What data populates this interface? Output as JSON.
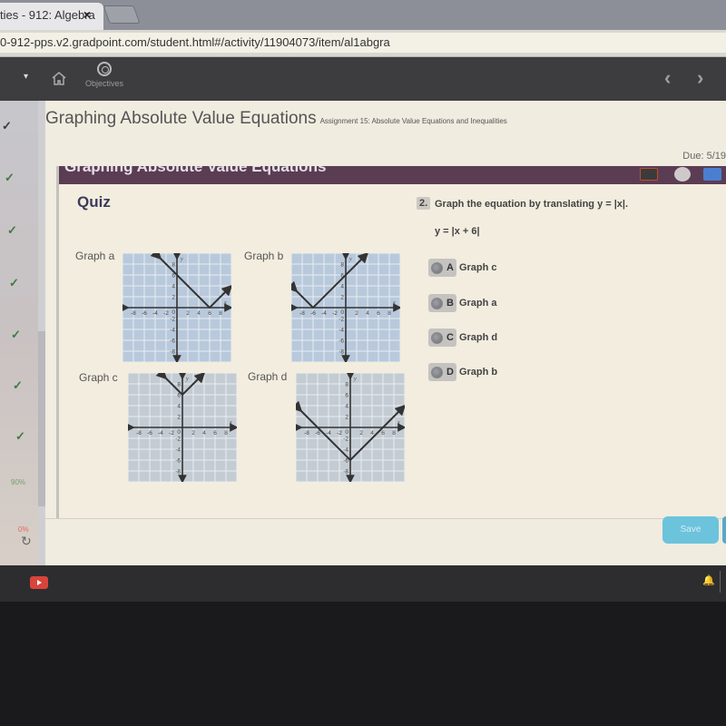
{
  "browser": {
    "tab_title": "ties - 912: Algebra",
    "tab_close": "×",
    "url": "0-912-pps.v2.gradpoint.com/student.html#/activity/11904073/item/al1abgra"
  },
  "app_nav": {
    "menu_caret": "▾",
    "home_icon": "home-icon",
    "objectives_label": "Objectives",
    "prev": "‹",
    "next": "›"
  },
  "sidebar": {
    "checks": [
      "✓",
      "✓",
      "✓",
      "✓",
      "✓",
      "✓",
      "✓"
    ],
    "progress_score": "90%",
    "progress_other": "0%",
    "reload": "↻"
  },
  "header": {
    "title": "Graphing Absolute Value Equations",
    "subtitle": "Assignment 15: Absolute Value Equations and Inequalities",
    "due": "Due: 5/19"
  },
  "frame": {
    "header_text": "Graphing Absolute Value Equations",
    "quiz_label": "Quiz"
  },
  "graphs": [
    {
      "label": "Graph a",
      "vertex": [
        6,
        0
      ],
      "opens": "up",
      "bg": "#b9c9dc"
    },
    {
      "label": "Graph b",
      "vertex": [
        -6,
        0
      ],
      "opens": "up",
      "bg": "#b9c9dc"
    },
    {
      "label": "Graph c",
      "vertex": [
        0,
        6
      ],
      "opens": "up",
      "bg": "#c4ccd3"
    },
    {
      "label": "Graph d",
      "vertex": [
        0,
        -6
      ],
      "opens": "up",
      "bg": "#c4ccd3"
    }
  ],
  "axis": {
    "x_ticks": [
      "-8",
      "-6",
      "-4",
      "-2",
      "2",
      "4",
      "6",
      "8"
    ],
    "y_ticks": [
      "8",
      "6",
      "4",
      "2",
      "-2",
      "-4",
      "-6",
      "-8"
    ],
    "origin": "0",
    "x_label": "x",
    "y_label": "y"
  },
  "question": {
    "number": "2.",
    "prompt": "Graph the equation by translating y = |x|.",
    "equation": "y = |x + 6|",
    "options": [
      {
        "letter": "A",
        "label": "Graph c"
      },
      {
        "letter": "B",
        "label": "Graph a"
      },
      {
        "letter": "C",
        "label": "Graph d"
      },
      {
        "letter": "D",
        "label": "Graph b"
      }
    ]
  },
  "footer": {
    "save_label": "Save"
  },
  "shelf": {
    "notification_icon": "bell-icon"
  }
}
